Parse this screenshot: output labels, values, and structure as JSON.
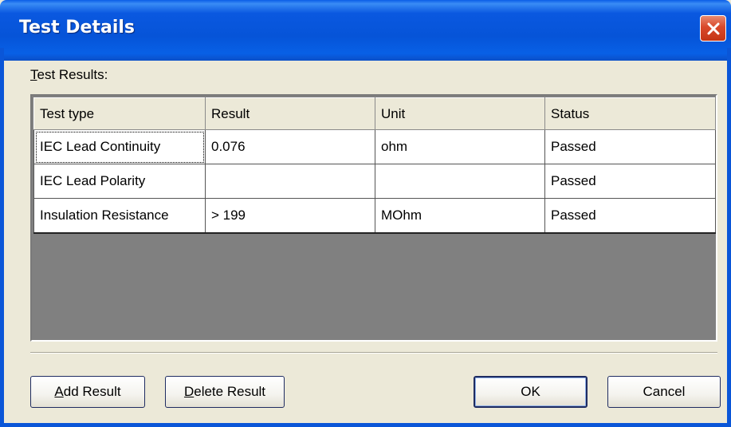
{
  "window": {
    "title": "Test Details"
  },
  "group": {
    "label_access": "T",
    "label_rest": "est Results:"
  },
  "table": {
    "columns": [
      "Test type",
      "Result",
      "Unit",
      "Status"
    ],
    "rows": [
      [
        "IEC Lead Continuity",
        "0.076",
        "ohm",
        "Passed"
      ],
      [
        "IEC Lead Polarity",
        "",
        "",
        "Passed"
      ],
      [
        "Insulation Resistance",
        "> 199",
        "MOhm",
        "Passed"
      ]
    ]
  },
  "buttons": {
    "add_access": "A",
    "add_rest": "dd Result",
    "delete_access": "D",
    "delete_rest": "elete Result",
    "ok": "OK",
    "cancel": "Cancel"
  },
  "icons": {
    "close": "close-icon"
  },
  "colors": {
    "titlebar": "#0654d8",
    "close": "#d9492b",
    "grid_empty": "#808080"
  }
}
